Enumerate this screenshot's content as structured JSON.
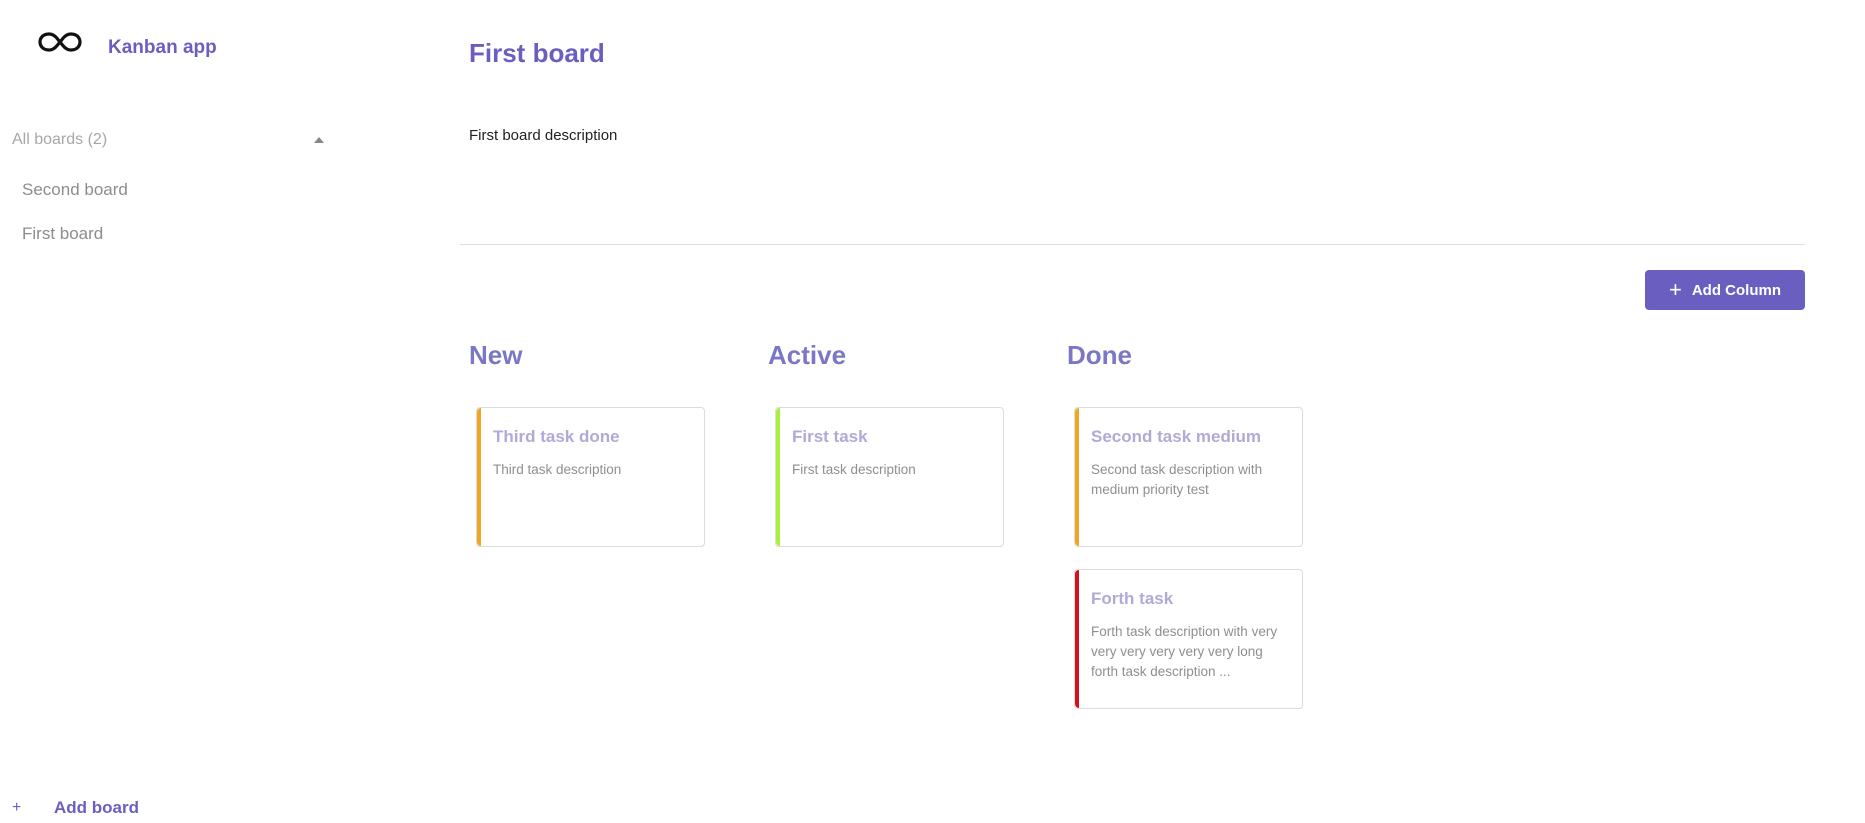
{
  "app": {
    "title": "Kanban app",
    "logo_icon": "infinity-icon"
  },
  "sidebar": {
    "boards_toggle_label": "All boards (2)",
    "toggle_icon": "caret-up-icon",
    "boards": [
      {
        "label": "Second board"
      },
      {
        "label": "First board"
      }
    ],
    "add_board_plus": "+",
    "add_board_label": "Add board"
  },
  "board": {
    "title": "First board",
    "description": "First board description",
    "add_column_label": "Add Column",
    "add_column_icon": "plus-icon"
  },
  "columns": [
    {
      "title": "New",
      "cards": [
        {
          "title": "Third task done",
          "description": "Third task description",
          "priority_color": "#f0a623"
        }
      ]
    },
    {
      "title": "Active",
      "cards": [
        {
          "title": "First task",
          "description": "First task description",
          "priority_color": "#a8f03a"
        }
      ]
    },
    {
      "title": "Done",
      "cards": [
        {
          "title": "Second task medium",
          "description": "Second task description with medium priority test",
          "priority_color": "#f0a623"
        },
        {
          "title": "Forth task",
          "description": "Forth task description with very very very very very very long forth task description ...",
          "priority_color": "#d4111d"
        }
      ]
    }
  ],
  "colors": {
    "accent": "#6a5fc1",
    "column_title": "#7b77c6",
    "card_title": "#b0aad7",
    "muted_text": "#8f8f8f"
  }
}
